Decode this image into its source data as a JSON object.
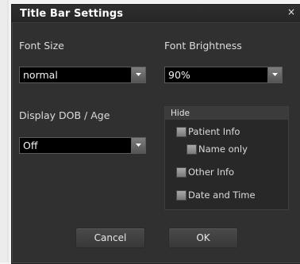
{
  "dialog": {
    "title": "Title Bar Settings",
    "close_glyph": "×"
  },
  "font_size": {
    "label": "Font Size",
    "selected": "normal"
  },
  "font_brightness": {
    "label": "Font Brightness",
    "selected": "90%"
  },
  "display_dob": {
    "label": "Display DOB / Age",
    "selected": "Off"
  },
  "hide": {
    "title": "Hide",
    "options": [
      {
        "label": "Patient Info",
        "checked": false
      },
      {
        "label": "Name only",
        "checked": false
      },
      {
        "label": "Other Info",
        "checked": false
      },
      {
        "label": "Date and Time",
        "checked": false
      }
    ]
  },
  "buttons": {
    "cancel": "Cancel",
    "ok": "OK"
  }
}
